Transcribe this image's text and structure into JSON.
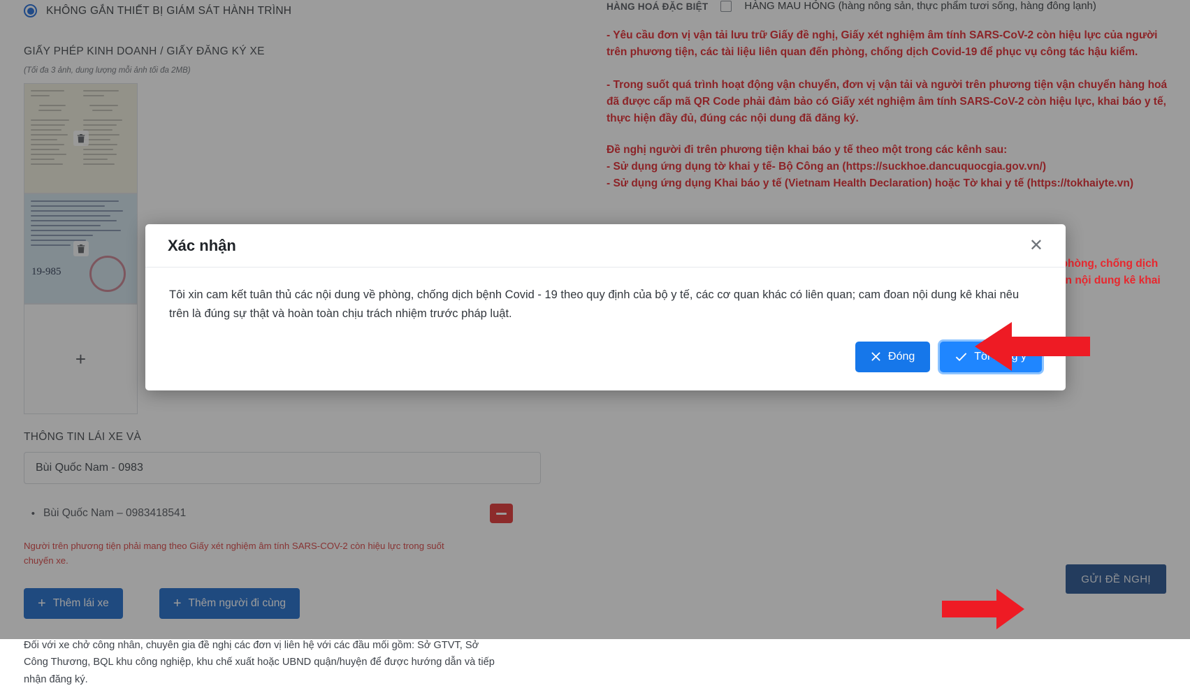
{
  "form": {
    "gps_option_label": "KHÔNG GẮN THIẾT BỊ GIÁM SÁT HÀNH TRÌNH",
    "license_section_title": "GIẤY PHÉP KINH DOANH / GIẤY ĐĂNG KÝ XE",
    "license_hint": "(Tối đa 3 ảnh, dung lượng mỗi ảnh tối đa 2MB)",
    "add_photo_glyph": "+",
    "driver_section_title": "THÔNG TIN LÁI XE VÀ",
    "driver_input_value": "Bùi Quốc Nam - 0983",
    "driver_list_bullet": "•",
    "driver_list_item": "Bùi Quốc Nam – 0983418541",
    "driver_warning": "Người trên phương tiện phải mang theo Giấy xét nghiệm âm tính SARS-COV-2 còn hiệu lực trong suốt chuyến xe.",
    "add_driver_label": "Thêm lái xe",
    "add_companion_label": "Thêm người đi cùng",
    "plus_glyph": "+",
    "footer_note": "Đối với xe chở công nhân, chuyên gia đề nghị các đơn vị liên hệ với các đầu mối gồm: Sở GTVT, Sở Công Thương, BQL khu công nghiệp, khu chế xuất hoặc UBND quận/huyện để được hướng dẫn và tiếp nhận đăng ký.",
    "submit_label": "GỬI ĐỀ NGHỊ"
  },
  "right_panel": {
    "special_goods_label": "HÀNG HOÁ ĐẶC BIỆT",
    "perishable_checkbox_label": "HÀNG MAU HỎNG (hàng nông sản, thực phẩm tươi sống, hàng đông lạnh)",
    "notice_1": "- Yêu cầu đơn vị vận tải lưu trữ Giấy đề nghị, Giấy xét nghiệm âm tính SARS-CoV-2 còn hiệu lực của người trên phương tiện, các tài liệu liên quan đến phòng, chống dịch Covid-19 để phục vụ công tác hậu kiểm.",
    "notice_2": "- Trong suốt quá trình hoạt động vận chuyển, đơn vị vận tải và người trên phương tiện vận chuyển hàng hoá đã được cấp mã QR Code phải đảm bảo có Giấy xét nghiệm âm tính SARS-CoV-2 còn hiệu lực, khai báo y tế, thực hiện đầy đủ, đúng các nội dung đã đăng ký.",
    "notice_3": "Đề nghị người đi trên phương tiện khai báo y tế theo một trong các kênh sau:",
    "notice_4": "- Sử dụng ứng dụng tờ khai y tế- Bộ Công an (https://suckhoe.dancuquocgia.gov.vn/)",
    "notice_5": "- Sử dụng ứng dụng Khai báo y tế (Vietnam Health Declaration) hoặc Tờ khai y tế (https://tokhaiyte.vn)",
    "notice_6_fragment_a": "về phòng, chống dịch",
    "notice_6_fragment_b": "đoan nội dung kê khai"
  },
  "modal": {
    "title": "Xác nhận",
    "close_glyph": "✕",
    "body": "Tôi xin cam kết tuân thủ các nội dung về phòng, chống dịch bệnh Covid - 19 theo quy định của bộ y tế, các cơ quan khác có liên quan; cam đoan nội dung kê khai nêu trên là đúng sự thật và hoàn toàn chịu trách nhiệm trước pháp luật.",
    "close_button_label": "Đóng",
    "agree_button_label": "Tôi đồng ý"
  },
  "colors": {
    "primary_blue": "#1677ea",
    "agree_blue": "#1f86ff",
    "danger_red": "#e02b2b",
    "notice_red": "#e01b22",
    "submit_navy": "#1b4a8a",
    "annotation_red": "#ee1b24"
  }
}
